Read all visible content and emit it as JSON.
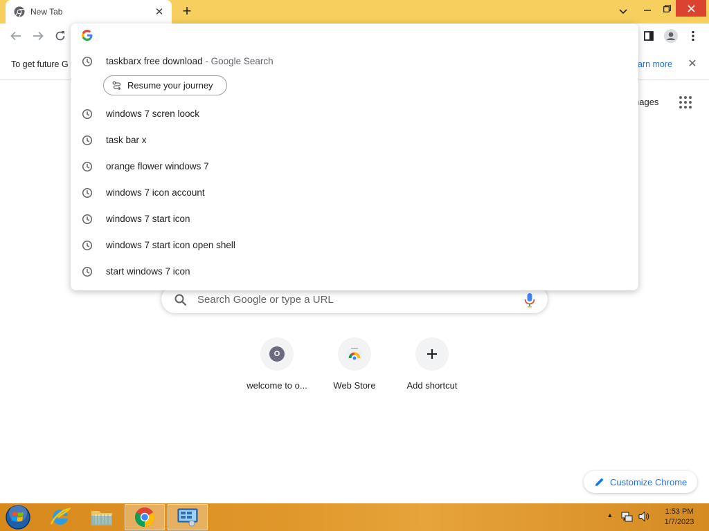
{
  "browser": {
    "tab_title": "New Tab",
    "new_tab_symbol": "+",
    "tab_close_symbol": "✕"
  },
  "infobar": {
    "text": "To get future G",
    "link": "earn more",
    "close_symbol": "✕"
  },
  "omnibox": {
    "suggestions": [
      {
        "text": "taskbarx free download",
        "suffix": " - Google Search"
      },
      {
        "text": "windows 7 scren loock"
      },
      {
        "text": "task bar x"
      },
      {
        "text": "orange flower windows 7"
      },
      {
        "text": "windows 7 icon account"
      },
      {
        "text": "windows 7 start icon"
      },
      {
        "text": "windows 7 start icon open shell"
      },
      {
        "text": "start windows 7 icon"
      }
    ],
    "journey_chip": "Resume your journey"
  },
  "ntp": {
    "images_link": "nages",
    "search_placeholder": "Search Google or type a URL",
    "shortcuts": [
      {
        "label": "welcome to o...",
        "avatar_letter": "O"
      },
      {
        "label": "Web Store"
      },
      {
        "label": "Add shortcut",
        "symbol": "+"
      }
    ],
    "customize_label": "Customize Chrome"
  },
  "taskbar": {
    "time": "1:53 PM",
    "date": "1/7/2023",
    "tray_arrow": "▲"
  },
  "colors": {
    "title_bar": "#f6cf5e",
    "close_button": "#d9432f",
    "accent_blue": "#1a73e8",
    "taskbar_orange": "#e0972a"
  },
  "icons": [
    "chrome-icon",
    "search-icon",
    "mic-icon",
    "history-icon",
    "google-g-icon",
    "journey-icon",
    "pencil-icon",
    "apps-grid-icon",
    "profile-icon",
    "side-panel-icon",
    "kebab-menu-icon"
  ]
}
